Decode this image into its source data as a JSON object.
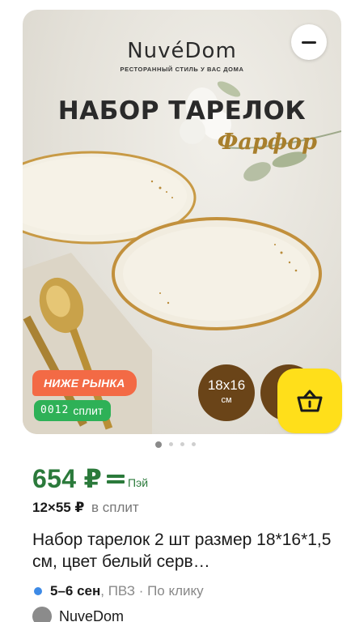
{
  "product_image": {
    "brand_logo": "NuvéDom",
    "brand_tagline": "РЕСТОРАННЫЙ СТИЛЬ У ВАС ДОМА",
    "promo_title": "НАБОР ТАРЕЛОК",
    "promo_subtitle": "Фарфор",
    "size_badge_main": "18x16",
    "size_badge_unit": "см"
  },
  "badges": {
    "below_market": "НИЖЕ РЫНКА",
    "split_digits": "0012",
    "split_label": "сплит"
  },
  "pagination": {
    "total": 4,
    "active": 1
  },
  "price": {
    "main": "654 ₽",
    "pay_label": "Пэй"
  },
  "installment": {
    "amount": "12×55 ₽",
    "note": "в сплит"
  },
  "product": {
    "title": "Набор тарелок 2 шт размер 18*16*1,5 см, цвет белый серв…"
  },
  "delivery": {
    "date": "5–6 сен",
    "extra": ", ПВЗ · По клику"
  },
  "seller": {
    "name": "NuveDom"
  },
  "colors": {
    "price_green": "#2b7a3b",
    "badge_orange": "#f36a45",
    "split_green": "#2eb157",
    "cart_yellow": "#ffdf1a",
    "size_brown": "#6a4418",
    "delivery_blue": "#3d8ae6"
  },
  "icons": {
    "remove": "minus-icon",
    "cart": "basket-icon",
    "pay": "pay-card-icon",
    "seller": "seller-avatar-icon"
  }
}
